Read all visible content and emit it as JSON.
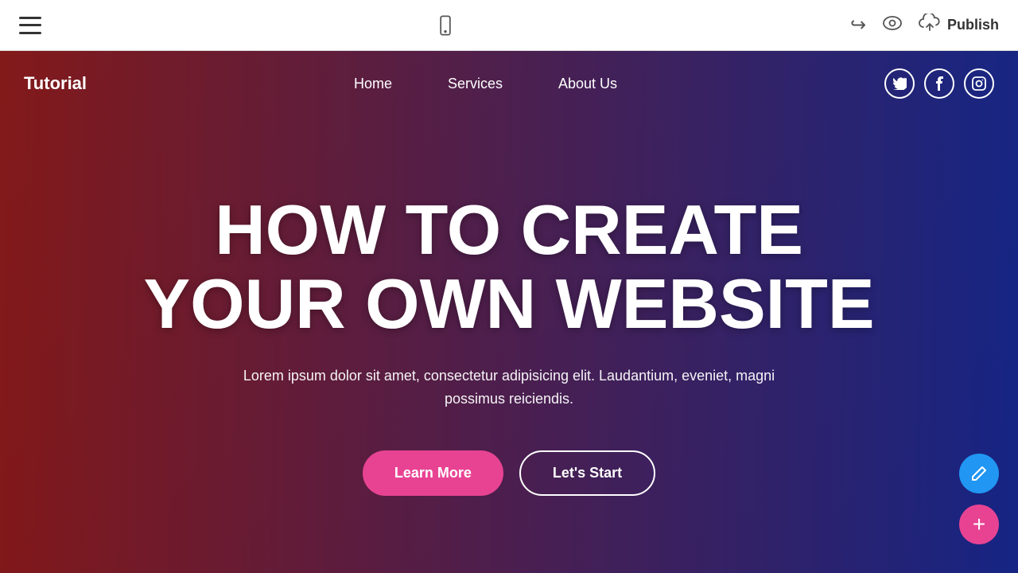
{
  "toolbar": {
    "hamburger_label": "menu",
    "phone_preview_label": "mobile preview",
    "undo_label": "undo",
    "preview_label": "preview",
    "publish_label": "Publish",
    "cloud_label": "cloud upload"
  },
  "site": {
    "logo": "Tutorial",
    "nav": {
      "links": [
        {
          "label": "Home",
          "href": "#"
        },
        {
          "label": "Services",
          "href": "#"
        },
        {
          "label": "About Us",
          "href": "#"
        }
      ],
      "social": [
        {
          "label": "Twitter",
          "icon": "T"
        },
        {
          "label": "Facebook",
          "icon": "f"
        },
        {
          "label": "Instagram",
          "icon": "in"
        }
      ]
    },
    "hero": {
      "title_line1": "HOW TO CREATE",
      "title_line2": "YOUR OWN WEBSITE",
      "subtitle": "Lorem ipsum dolor sit amet, consectetur adipisicing elit. Laudantium, eveniet, magni possimus reiciendis.",
      "btn_learn_more": "Learn More",
      "btn_lets_start": "Let's Start"
    }
  },
  "fab": {
    "edit_icon": "✎",
    "add_icon": "+"
  },
  "colors": {
    "accent_pink": "#e84393",
    "accent_blue": "#2196F3",
    "gradient_left": "rgba(160,20,20,0.75)",
    "gradient_right": "rgba(20,40,160,0.75)"
  }
}
